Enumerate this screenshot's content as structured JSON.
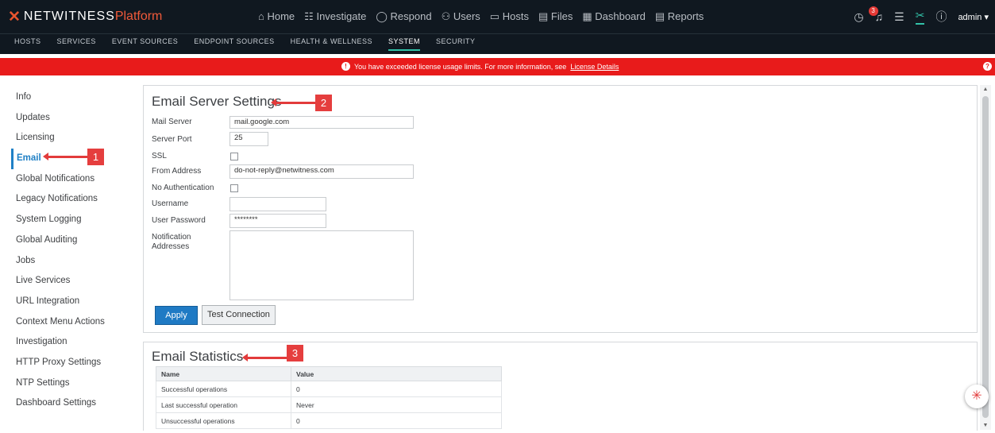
{
  "header": {
    "logo_main": "NETWITNESS",
    "logo_accent": "Platform",
    "nav": [
      {
        "icon": "home-icon",
        "glyph": "⌂",
        "label": "Home"
      },
      {
        "icon": "investigate-icon",
        "glyph": "☷",
        "label": "Investigate"
      },
      {
        "icon": "respond-icon",
        "glyph": "◯",
        "label": "Respond"
      },
      {
        "icon": "users-icon",
        "glyph": "⚇",
        "label": "Users"
      },
      {
        "icon": "hosts-icon",
        "glyph": "▭",
        "label": "Hosts"
      },
      {
        "icon": "files-icon",
        "glyph": "▤",
        "label": "Files"
      },
      {
        "icon": "dashboard-icon",
        "glyph": "▦",
        "label": "Dashboard"
      },
      {
        "icon": "reports-icon",
        "glyph": "▤",
        "label": "Reports"
      }
    ],
    "notification_count": "3",
    "user": "admin"
  },
  "subnav": [
    "HOSTS",
    "SERVICES",
    "EVENT SOURCES",
    "ENDPOINT SOURCES",
    "HEALTH & WELLNESS",
    "SYSTEM",
    "SECURITY"
  ],
  "subnav_active": "SYSTEM",
  "alert": {
    "message": "You have exceeded license usage limits. For more information, see",
    "link": "License Details"
  },
  "sidebar": {
    "items": [
      "Info",
      "Updates",
      "Licensing",
      "Email",
      "Global Notifications",
      "Legacy Notifications",
      "System Logging",
      "Global Auditing",
      "Jobs",
      "Live Services",
      "URL Integration",
      "Context Menu Actions",
      "Investigation",
      "HTTP Proxy Settings",
      "NTP Settings",
      "Dashboard Settings"
    ],
    "active": "Email"
  },
  "email_settings": {
    "title": "Email Server Settings",
    "mail_server_label": "Mail Server",
    "mail_server": "mail.google.com",
    "server_port_label": "Server Port",
    "server_port": "25",
    "ssl_label": "SSL",
    "ssl": false,
    "from_address_label": "From Address",
    "from_address": "do-not-reply@netwitness.com",
    "no_auth_label": "No Authentication",
    "no_auth": false,
    "username_label": "Username",
    "username": "",
    "password_label": "User Password",
    "password": "********",
    "notification_label_1": "Notification",
    "notification_label_2": "Addresses",
    "notification_addresses": "",
    "apply_label": "Apply",
    "test_label": "Test Connection"
  },
  "email_stats": {
    "title": "Email Statistics",
    "headers": [
      "Name",
      "Value"
    ],
    "rows": [
      [
        "Successful operations",
        "0"
      ],
      [
        "Last successful operation",
        "Never"
      ],
      [
        "Unsuccessful operations",
        "0"
      ]
    ]
  },
  "callouts": [
    "1",
    "2",
    "3"
  ]
}
